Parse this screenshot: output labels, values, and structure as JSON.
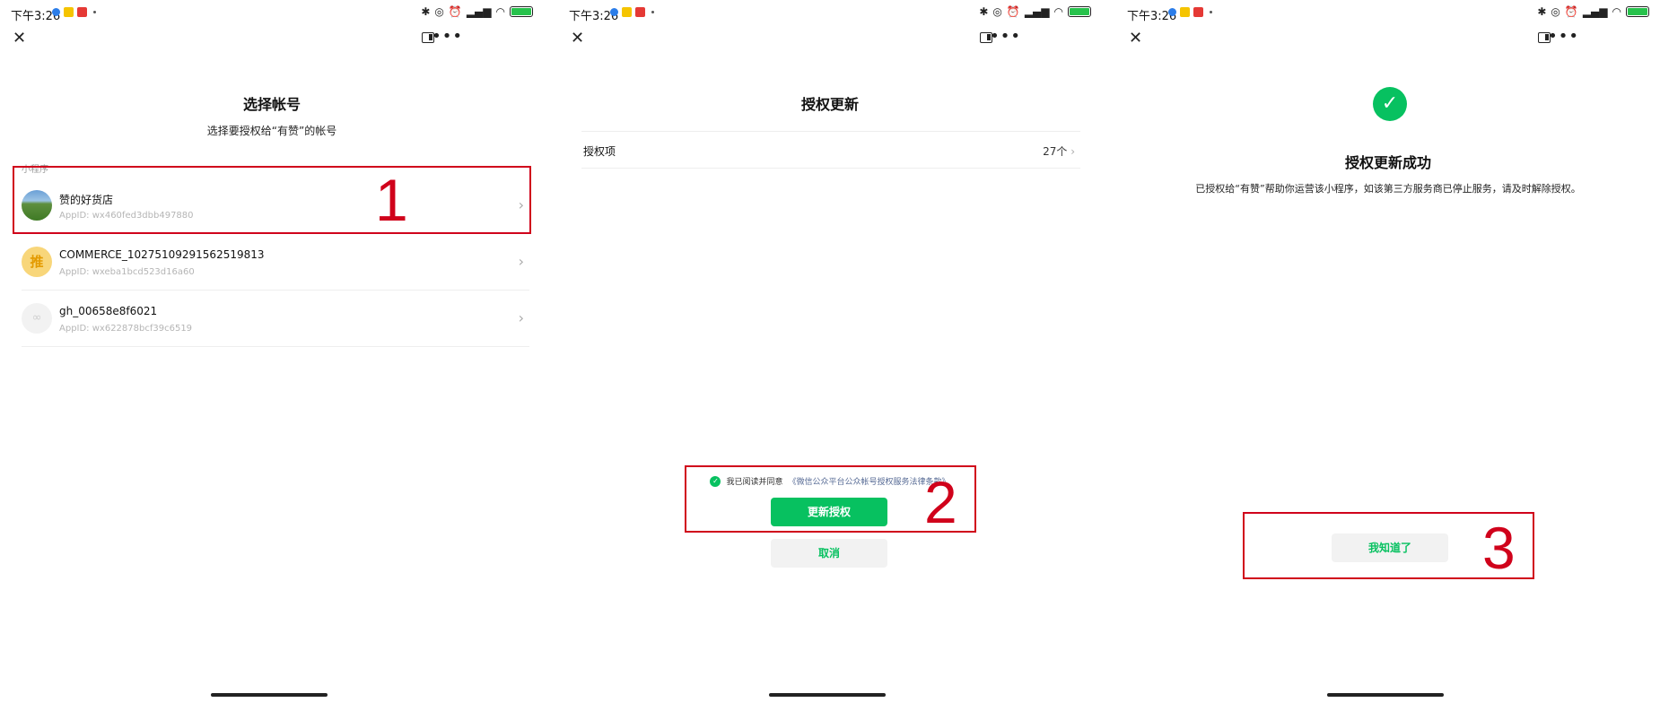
{
  "status": {
    "time": "下午3:26"
  },
  "p1": {
    "title": "选择帐号",
    "subtitle": "选择要授权给“有赞”的帐号",
    "section": "小程序",
    "accounts": [
      {
        "name": "赞的好货店",
        "appid": "AppID: wx460fed3dbb497880"
      },
      {
        "name": "COMMERCE_10275109291562519813",
        "appid": "AppID: wxeba1bcd523d16a60",
        "avatar_text": "推"
      },
      {
        "name": "gh_00658e8f6021",
        "appid": "AppID: wx622878bcf39c6519"
      }
    ],
    "step": "1"
  },
  "p2": {
    "title": "授权更新",
    "row_label": "授权项",
    "row_value": "27个",
    "agree_prefix": "我已阅读并同意",
    "agree_link": "《微信公众平台公众帐号授权服务法律条款》",
    "primary_btn": "更新授权",
    "cancel_btn": "取消",
    "step": "2"
  },
  "p3": {
    "title": "授权更新成功",
    "desc": "已授权给“有赞”帮助你运营该小程序，如该第三方服务商已停止服务，请及时解除授权。",
    "ok_btn": "我知道了",
    "step": "3"
  },
  "colors": {
    "accent": "#07c160",
    "annotation": "#d0021b",
    "link": "#576b95"
  }
}
